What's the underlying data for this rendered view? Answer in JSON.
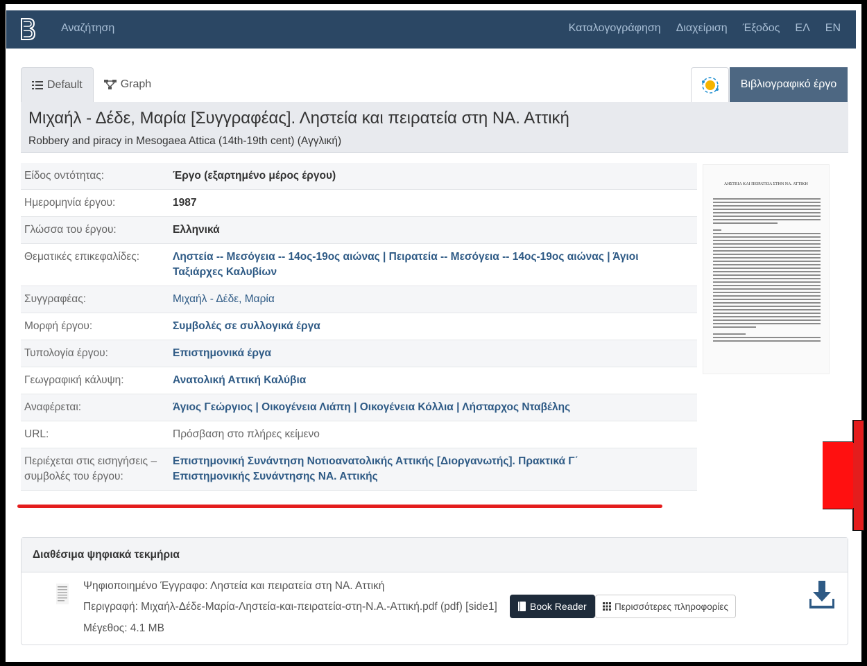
{
  "nav": {
    "search": "Αναζήτηση",
    "items": [
      "Καταλογογράφηση",
      "Διαχείριση",
      "Έξοδος",
      "ΕΛ",
      "EN"
    ]
  },
  "tabs": {
    "default": "Default",
    "graph": "Graph",
    "entity_type": "Βιβλιογραφικό έργο"
  },
  "title": {
    "main": "Μιχαήλ - Δέδε, Μαρία [Συγγραφέας]. Ληστεία και πειρατεία στη ΝΑ. Αττική",
    "sub": "Robbery and piracy in Mesogaea Attica (14th-19th cent) (Αγγλική)"
  },
  "metadata": [
    {
      "label": "Είδος οντότητας:",
      "value": "Έργο (εξαρτημένο μέρος έργου)"
    },
    {
      "label": "Ημερομηνία έργου:",
      "value": "1987"
    },
    {
      "label": "Γλώσσα του έργου:",
      "value": "Ελληνικά"
    },
    {
      "label": "Θεματικές επικεφαλίδες:",
      "value": "Ληστεία -- Μεσόγεια -- 14ος-19ος αιώνας | Πειρατεία -- Μεσόγεια -- 14ος-19ος αιώνας | Άγιοι Ταξιάρχες Καλυβίων"
    },
    {
      "label": "Συγγραφέας:",
      "value": "Μιχαήλ - Δέδε, Μαρία"
    },
    {
      "label": "Μορφή έργου:",
      "value": "Συμβολές σε συλλογικά έργα"
    },
    {
      "label": "Τυπολογία έργου:",
      "value": "Επιστημονικά έργα"
    },
    {
      "label": "Γεωγραφική κάλυψη:",
      "value": "Ανατολική Αττική Καλύβια"
    },
    {
      "label": "Αναφέρεται:",
      "value": "Άγιος Γεώργιος | Οικογένεια Λιάπη | Οικογένεια Κόλλια | Λήσταρχος Νταβέλης"
    },
    {
      "label": "URL:",
      "value": "Πρόσβαση στο πλήρες κείμενο"
    },
    {
      "label": "Περιέχεται στις εισηγήσεις – συμβολές του έργου:",
      "value": "Επιστημονική Συνάντηση Νοτιοανατολικής Αττικής [Διοργανωτής]. Πρακτικά Γ΄ Επιστημονικής Συνάντησης ΝΑ. Αττικής"
    }
  ],
  "thumbnail": {
    "doc_title": "ΛΗΣΤΕΙΑ ΚΑΙ ΠΕΙΡΑΤΕΙΑ ΣΤΗΝ ΝΑ. ΑΤΤΙΚΗ"
  },
  "files": {
    "heading": "Διαθέσιμα ψηφιακά τεκμήρια",
    "doc_line": "Ψηφιοποιημένο Έγγραφο: Ληστεία και πειρατεία στη ΝΑ. Αττική",
    "desc_line": "Περιγραφή: Μιχαήλ-Δέδε-Μαρία-Ληστεία-και-πειρατεία-στη-Ν.Α.-Αττική.pdf (pdf) [side1]",
    "size_line": "Μέγεθος: 4.1 MB",
    "book_reader": "Book Reader",
    "more_info": "Περισσότερες πληροφορίες"
  },
  "colors": {
    "navbar": "#2b4764",
    "entity_button": "#4d6782",
    "link": "#2e5a85",
    "annotation_red": "#e41d1d"
  }
}
